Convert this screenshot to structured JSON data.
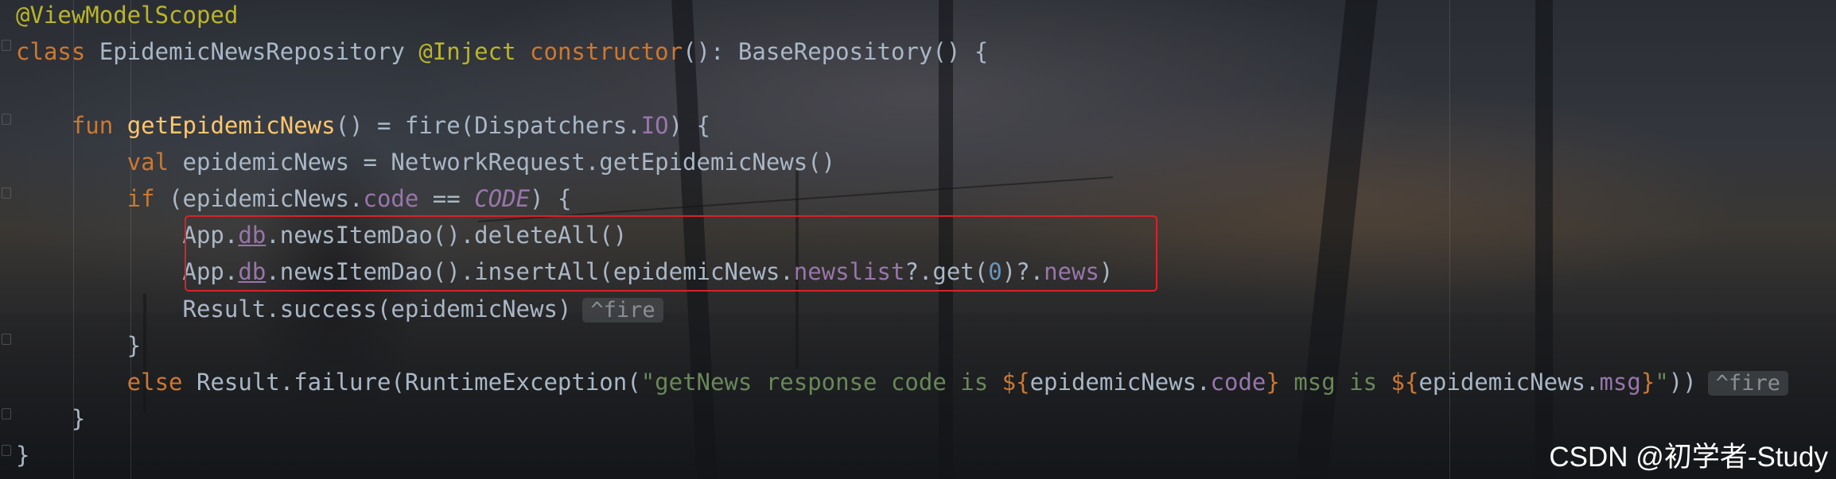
{
  "editor": {
    "lines": [
      {
        "parts": [
          {
            "t": "@ViewModelScoped",
            "c": "ann"
          }
        ]
      },
      {
        "parts": [
          {
            "t": "class ",
            "c": "kw"
          },
          {
            "t": "EpidemicNewsRepository "
          },
          {
            "t": "@Inject ",
            "c": "ann"
          },
          {
            "t": "constructor",
            "c": "kw"
          },
          {
            "t": "(): BaseRepository() {"
          }
        ]
      },
      {
        "parts": []
      },
      {
        "parts": [
          {
            "t": "    fun ",
            "c": "kw"
          },
          {
            "t": "getEpidemicNews",
            "c": "fn"
          },
          {
            "t": "() = fire(Dispatchers."
          },
          {
            "t": "IO",
            "c": "prop"
          },
          {
            "t": ") {"
          }
        ]
      },
      {
        "parts": [
          {
            "t": "        val ",
            "c": "kw"
          },
          {
            "t": "epidemicNews = NetworkRequest.getEpidemicNews()"
          }
        ]
      },
      {
        "parts": [
          {
            "t": "        if ",
            "c": "kw"
          },
          {
            "t": "(epidemicNews."
          },
          {
            "t": "code",
            "c": "prop"
          },
          {
            "t": " == "
          },
          {
            "t": "CODE",
            "c": "prop ital"
          },
          {
            "t": ") {"
          }
        ]
      },
      {
        "parts": [
          {
            "t": "            App."
          },
          {
            "t": "db",
            "c": "prop und"
          },
          {
            "t": ".newsItemDao().deleteAll()"
          }
        ]
      },
      {
        "parts": [
          {
            "t": "            App."
          },
          {
            "t": "db",
            "c": "prop und"
          },
          {
            "t": ".newsItemDao().insertAll(epidemicNews."
          },
          {
            "t": "newslist",
            "c": "prop"
          },
          {
            "t": "?.get("
          },
          {
            "t": "0",
            "c": "num"
          },
          {
            "t": ")?."
          },
          {
            "t": "news",
            "c": "prop"
          },
          {
            "t": ")"
          }
        ]
      },
      {
        "parts": [
          {
            "t": "            Result.success(epidemicNews)"
          },
          {
            "t": "^fire",
            "c": "hint"
          }
        ]
      },
      {
        "parts": [
          {
            "t": "        }"
          }
        ]
      },
      {
        "parts": [
          {
            "t": "        else ",
            "c": "kw"
          },
          {
            "t": "Result.failure(RuntimeException("
          },
          {
            "t": "\"getNews response code is ",
            "c": "str"
          },
          {
            "t": "${",
            "c": "kw"
          },
          {
            "t": "epidemicNews."
          },
          {
            "t": "code",
            "c": "prop"
          },
          {
            "t": "}",
            "c": "kw"
          },
          {
            "t": " msg is ",
            "c": "str"
          },
          {
            "t": "${",
            "c": "kw"
          },
          {
            "t": "epidemicNews."
          },
          {
            "t": "msg",
            "c": "prop"
          },
          {
            "t": "}",
            "c": "kw"
          },
          {
            "t": "\"",
            "c": "str"
          },
          {
            "t": "))"
          },
          {
            "t": "^fire",
            "c": "hint"
          }
        ]
      },
      {
        "parts": [
          {
            "t": "    }"
          }
        ]
      },
      {
        "parts": [
          {
            "t": "}"
          }
        ]
      }
    ]
  },
  "watermark": {
    "text": "CSDN @初学者-Study"
  }
}
